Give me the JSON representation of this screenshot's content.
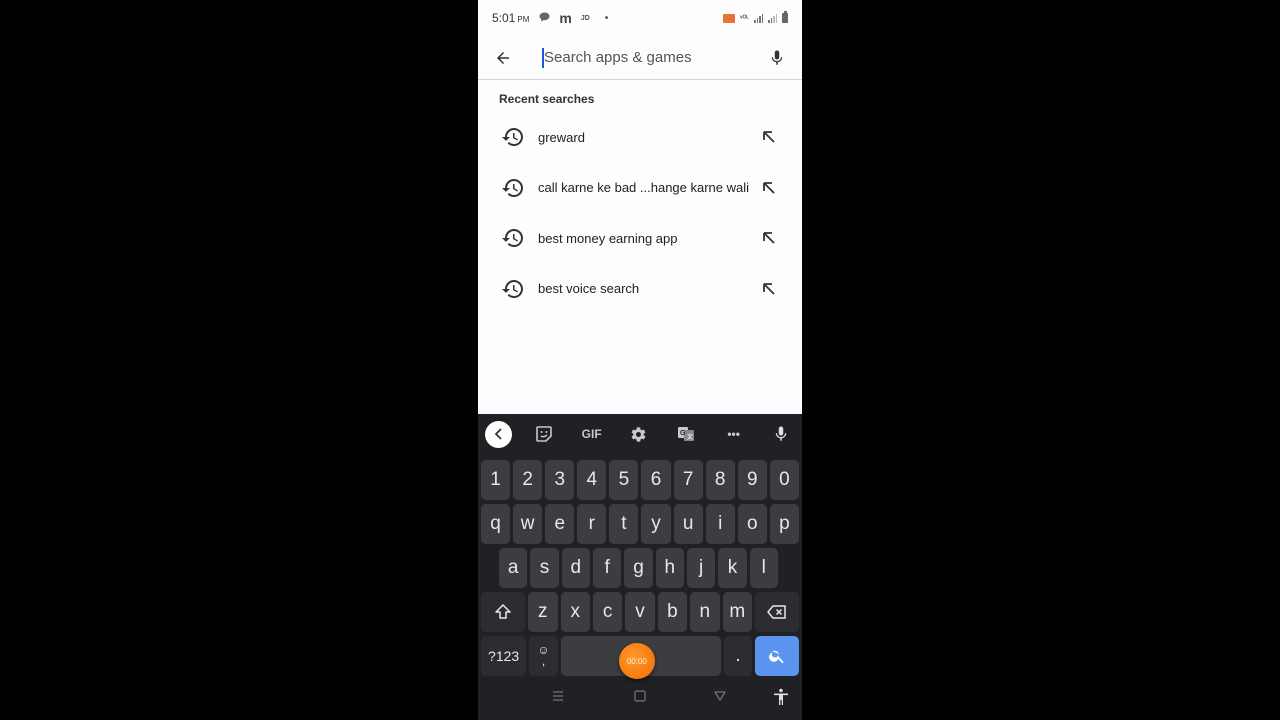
{
  "status_bar": {
    "time": "5:01",
    "ampm": "PM",
    "left_icons": [
      "chat-bubble-icon",
      "m-app-icon",
      "jd-app-icon",
      "dot-icon"
    ],
    "left_labels": {
      "m": "m",
      "jd": "JD",
      "dot": "•"
    },
    "right_icons": [
      "cast-icon",
      "volte-icon",
      "signal-icon",
      "signal-icon-2",
      "battery-icon"
    ],
    "volte_label": "ᵛᴼᴸ"
  },
  "search": {
    "placeholder": "Search apps & games",
    "value": ""
  },
  "recent": {
    "title": "Recent searches",
    "items": [
      {
        "text": "greward"
      },
      {
        "text": "call karne ke bad ...hange karne wali"
      },
      {
        "text": "best money earning app"
      },
      {
        "text": "best voice search"
      }
    ]
  },
  "keyboard": {
    "toolbar": {
      "gif_label": "GIF",
      "more_label": "•••"
    },
    "rows": [
      [
        "1",
        "2",
        "3",
        "4",
        "5",
        "6",
        "7",
        "8",
        "9",
        "0"
      ],
      [
        "q",
        "w",
        "e",
        "r",
        "t",
        "y",
        "u",
        "i",
        "o",
        "p"
      ],
      [
        "a",
        "s",
        "d",
        "f",
        "g",
        "h",
        "j",
        "k",
        "l"
      ],
      [
        "z",
        "x",
        "c",
        "v",
        "b",
        "n",
        "m"
      ]
    ],
    "symbols_label": "?123",
    "emoji_comma_top": "☺",
    "emoji_comma_bottom": ",",
    "period_label": ".",
    "recording_timer": "00:00"
  },
  "colors": {
    "accent_blue": "#5a93f0",
    "cursor_blue": "#1a56d6",
    "record_orange": "#f26a00",
    "keyboard_bg": "#202124",
    "key_bg": "#3c3d41"
  }
}
